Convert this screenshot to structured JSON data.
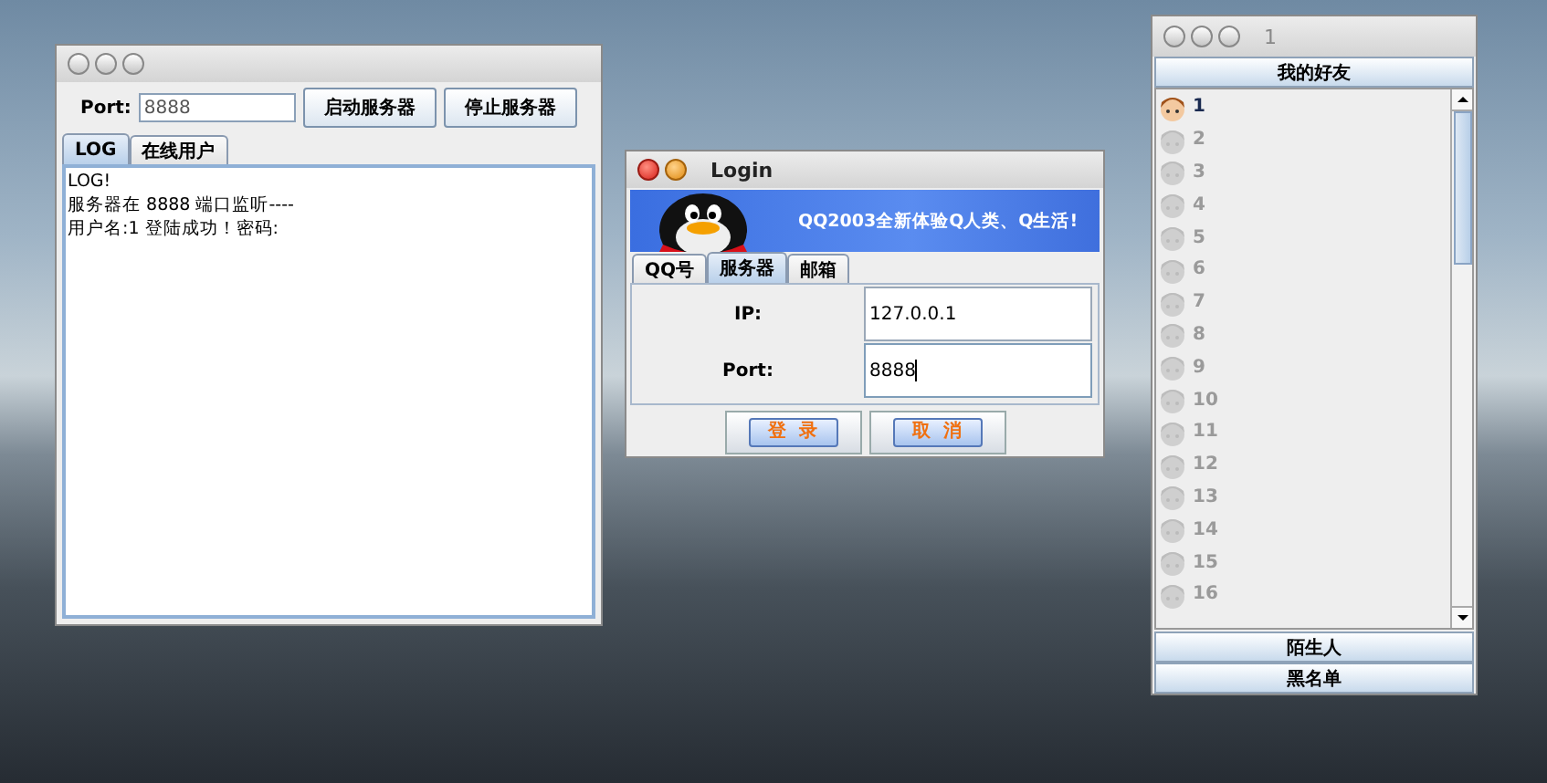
{
  "server_window": {
    "active": false,
    "resizable": true,
    "port_label": "Port:",
    "port_value": "8888",
    "buttons": [
      "启动服务器",
      "停止服务器"
    ],
    "tabs": [
      {
        "label": "LOG",
        "selected": true
      },
      {
        "label": "在线用户",
        "selected": false
      }
    ],
    "log_lines": [
      "LOG!",
      "服务器在 8888 端口监听----",
      "用户名:1 登陆成功！密码:"
    ]
  },
  "login_window": {
    "title": "Login",
    "active": true,
    "resizable": false,
    "banner_text": "QQ2003全新体验Q人类、Q生活!",
    "tabs": [
      {
        "label": "QQ号",
        "selected": false
      },
      {
        "label": "服务器",
        "selected": true
      },
      {
        "label": "邮箱",
        "selected": false
      }
    ],
    "fields": [
      {
        "label": "IP:",
        "value": "127.0.0.1",
        "focused": false
      },
      {
        "label": "Port:",
        "value": "8888",
        "focused": true
      }
    ],
    "buttons": [
      "登  录",
      "取  消"
    ]
  },
  "friends_window": {
    "title": "1",
    "active": false,
    "resizable": true,
    "groups_top": [
      "我的好友"
    ],
    "friends": [
      {
        "name": "1",
        "online": true
      },
      {
        "name": "2",
        "online": false
      },
      {
        "name": "3",
        "online": false
      },
      {
        "name": "4",
        "online": false
      },
      {
        "name": "5",
        "online": false
      },
      {
        "name": "6",
        "online": false
      },
      {
        "name": "7",
        "online": false
      },
      {
        "name": "8",
        "online": false
      },
      {
        "name": "9",
        "online": false
      },
      {
        "name": "10",
        "online": false
      },
      {
        "name": "11",
        "online": false
      },
      {
        "name": "12",
        "online": false
      },
      {
        "name": "13",
        "online": false
      },
      {
        "name": "14",
        "online": false
      },
      {
        "name": "15",
        "online": false
      },
      {
        "name": "16",
        "online": false
      }
    ],
    "groups_bottom": [
      "陌生人",
      "黑名单"
    ]
  }
}
